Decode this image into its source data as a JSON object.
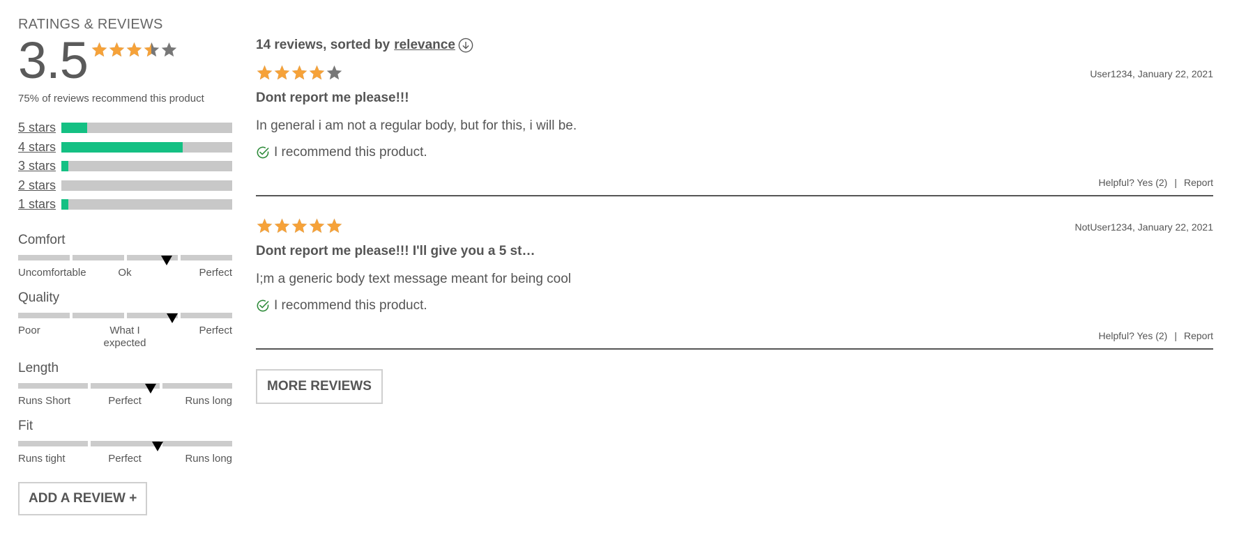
{
  "ratings": {
    "heading": "RATINGS & REVIEWS",
    "average": "3.5",
    "average_value": 3.5,
    "recommend_text": "75% of reviews recommend this product",
    "star_color": "#f6a239",
    "star_empty_color": "#777777",
    "breakdown": [
      {
        "label": "5 stars",
        "fraction": 0.15
      },
      {
        "label": "4 stars",
        "fraction": 0.71
      },
      {
        "label": "3 stars",
        "fraction": 0.04
      },
      {
        "label": "2 stars",
        "fraction": 0.0
      },
      {
        "label": "1 stars",
        "fraction": 0.04
      }
    ],
    "bar_fill_color": "#14c083"
  },
  "characteristics": [
    {
      "name": "Comfort",
      "segments": 4,
      "value": 0.695,
      "labels": [
        "Uncomfortable",
        "Ok",
        "Perfect"
      ]
    },
    {
      "name": "Quality",
      "segments": 4,
      "value": 0.72,
      "labels": [
        "Poor",
        "What I expected",
        "Perfect"
      ]
    },
    {
      "name": "Length",
      "segments": 3,
      "value": 0.62,
      "labels": [
        "Runs Short",
        "Perfect",
        "Runs long"
      ]
    },
    {
      "name": "Fit",
      "segments": 3,
      "value": 0.65,
      "labels": [
        "Runs tight",
        "Perfect",
        "Runs long"
      ]
    }
  ],
  "add_review_label": "ADD A REVIEW +",
  "sort": {
    "prefix": "14 reviews, sorted by",
    "option": "relevance",
    "icon": "circle-arrow-down-icon"
  },
  "reviews": [
    {
      "rating": 4,
      "user_date": "User1234, January 22, 2021",
      "title": "Dont report me please!!!",
      "body": "In general i am not a regular body, but for this, i will be.",
      "recommend": "I recommend this product.",
      "helpful": "Helpful? Yes (2)",
      "separator": "|",
      "report": "Report"
    },
    {
      "rating": 5,
      "user_date": "NotUser1234, January 22, 2021",
      "title": "Dont report me please!!! I'll give you a 5 st…",
      "body": "I;m a generic body text message meant for being cool",
      "recommend": "I recommend this product.",
      "helpful": "Helpful? Yes (2)",
      "separator": "|",
      "report": "Report"
    }
  ],
  "more_reviews_label": "MORE REVIEWS",
  "check_color": "#2e8b3a"
}
